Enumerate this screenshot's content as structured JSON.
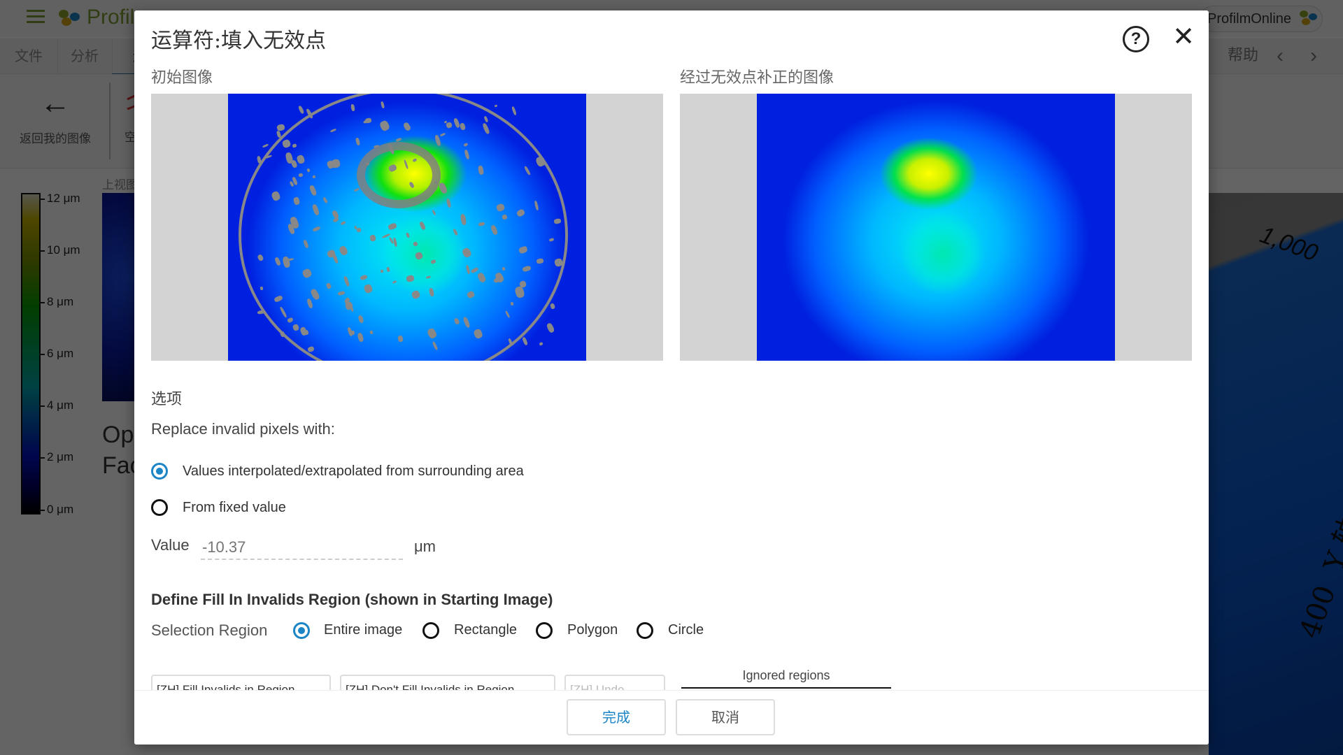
{
  "app": {
    "brand": "Profilm",
    "account_label": "ProfilmOnline",
    "tabs": [
      "文件",
      "分析",
      "运"
    ],
    "help_tab": "帮助",
    "nav_prev": "‹",
    "nav_next": "›",
    "back_button_label": "返回我的图像",
    "next_tool_label": "空",
    "panel_label": "上视图",
    "op_text_line1": "Op",
    "op_text_line2": "Fac",
    "colorbar_ticks": [
      "12 μm",
      "10 μm",
      "8 μm",
      "6 μm",
      "4 μm",
      "2 μm",
      "0 μm"
    ],
    "view3d_tick": "1,000",
    "view3d_tick2": "400",
    "view3d_axis_label": "Y 轴-距离"
  },
  "dialog": {
    "title": "运算符:填入无效点",
    "help_icon": "?",
    "close_icon": "✕",
    "starting_image_label": "初始图像",
    "corrected_image_label": "经过无效点补正的图像",
    "options_title": "选项",
    "replace_label": "Replace invalid pixels with:",
    "replace_options": [
      {
        "label": "Values interpolated/extrapolated from surrounding area",
        "selected": true
      },
      {
        "label": "From fixed value",
        "selected": false
      }
    ],
    "value_label": "Value",
    "value_placeholder": "-10.37",
    "value_unit": "μm",
    "region_title": "Define Fill In Invalids Region (shown in Starting Image)",
    "selection_region_label": "Selection Region",
    "region_options": [
      {
        "label": "Entire image",
        "selected": true
      },
      {
        "label": "Rectangle",
        "selected": false
      },
      {
        "label": "Polygon",
        "selected": false
      },
      {
        "label": "Circle",
        "selected": false
      }
    ],
    "region_buttons": [
      {
        "label": "[ZH] Fill Invalids in Region",
        "enabled": true
      },
      {
        "label": "[ZH] Don't Fill Invalids in Region",
        "enabled": true
      },
      {
        "label": "[ZH] Undo",
        "enabled": false
      }
    ],
    "ignored_regions_tab": "Ignored regions",
    "done_button": "完成",
    "cancel_button": "取消"
  },
  "colors": {
    "accent": "#1b85c6",
    "brand_green": "#7a9a2e"
  }
}
